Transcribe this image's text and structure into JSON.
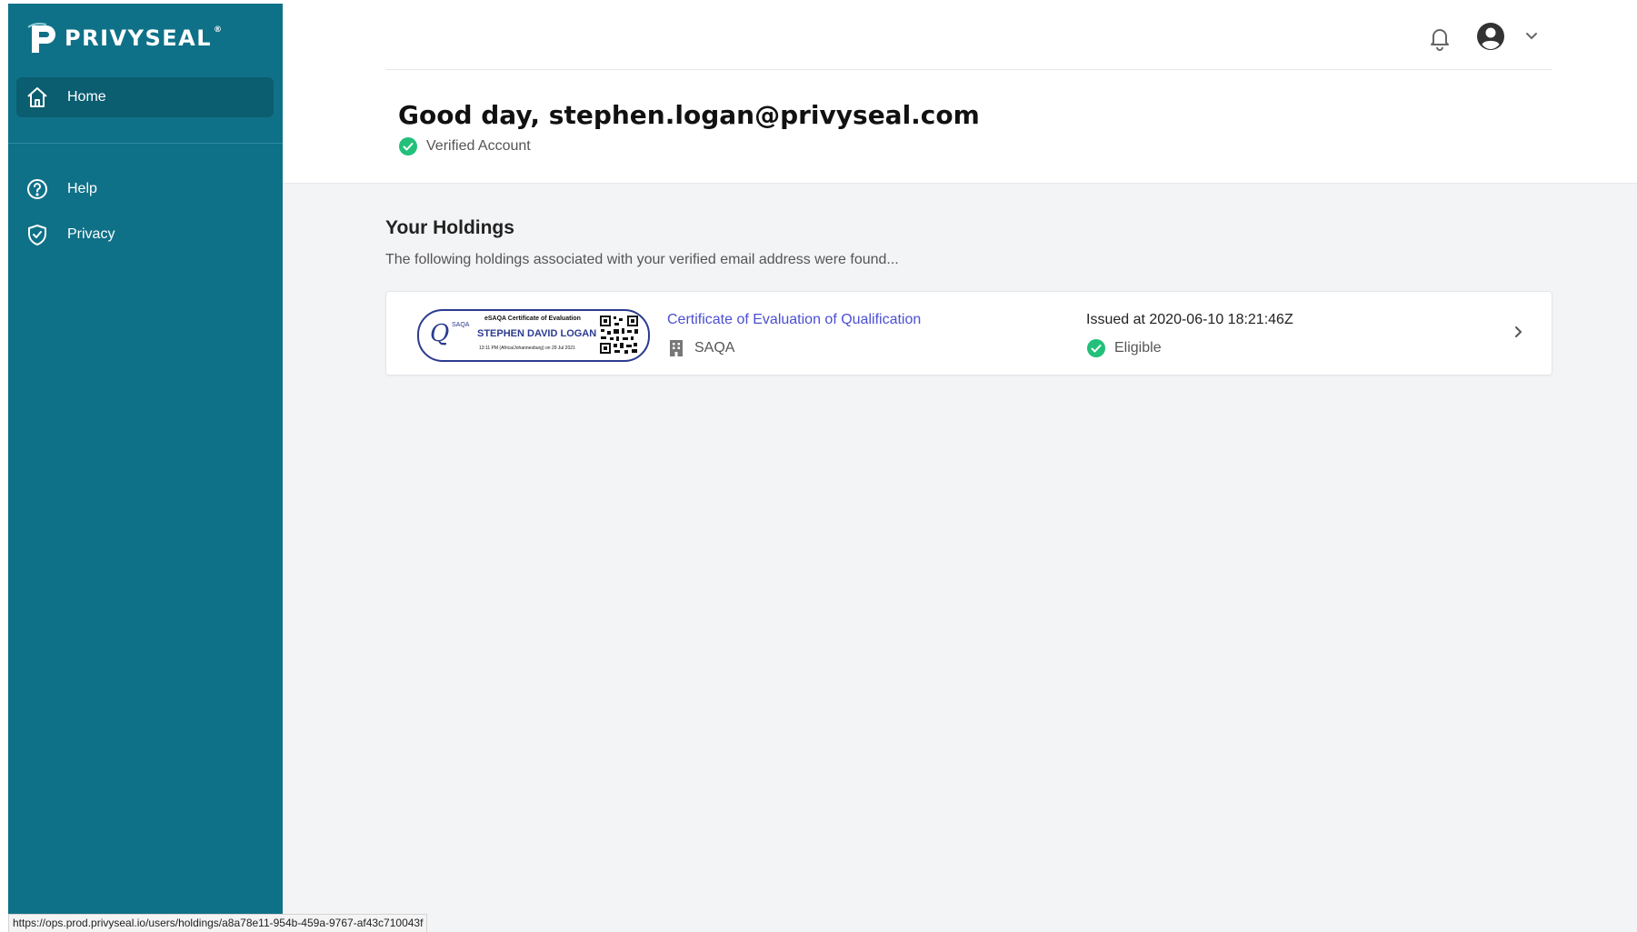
{
  "brand": {
    "name": "PRIVYSEAL",
    "reg": "®"
  },
  "sidebar": {
    "items": [
      {
        "label": "Home",
        "icon": "home-icon",
        "active": true
      },
      {
        "label": "Help",
        "icon": "help-circle-icon",
        "active": false
      },
      {
        "label": "Privacy",
        "icon": "shield-check-icon",
        "active": false
      }
    ]
  },
  "header": {
    "icons": [
      "bell-icon",
      "user-avatar-icon",
      "chevron-down-icon"
    ],
    "greeting": "Good day, stephen.logan@privyseal.com",
    "verified_label": "Verified Account"
  },
  "holdings": {
    "title": "Your Holdings",
    "subtitle": "The following holdings associated with your verified email address were found...",
    "items": [
      {
        "thumbnail": {
          "logo_letter": "Q",
          "logo_text": "SAQA",
          "line1": "eSAQA Certificate of Evaluation",
          "name": "STEPHEN  DAVID LOGAN",
          "line2": "13:11 PM (Africa/Johannesburg) on 29 Jul 2021"
        },
        "title": "Certificate of Evaluation of Qualification",
        "issuer": "SAQA",
        "issued": "Issued at 2020-06-10 18:21:46Z",
        "status": "Eligible"
      }
    ]
  },
  "status_bar": {
    "url": "https://ops.prod.privyseal.io/users/holdings/a8a78e11-954b-459a-9767-af43c710043f"
  },
  "colors": {
    "sidebar_bg": "#0f7188",
    "sidebar_active": "#0b5d70",
    "link": "#4b4fd1",
    "success": "#22c07a",
    "content_bg": "#f3f4f6"
  }
}
